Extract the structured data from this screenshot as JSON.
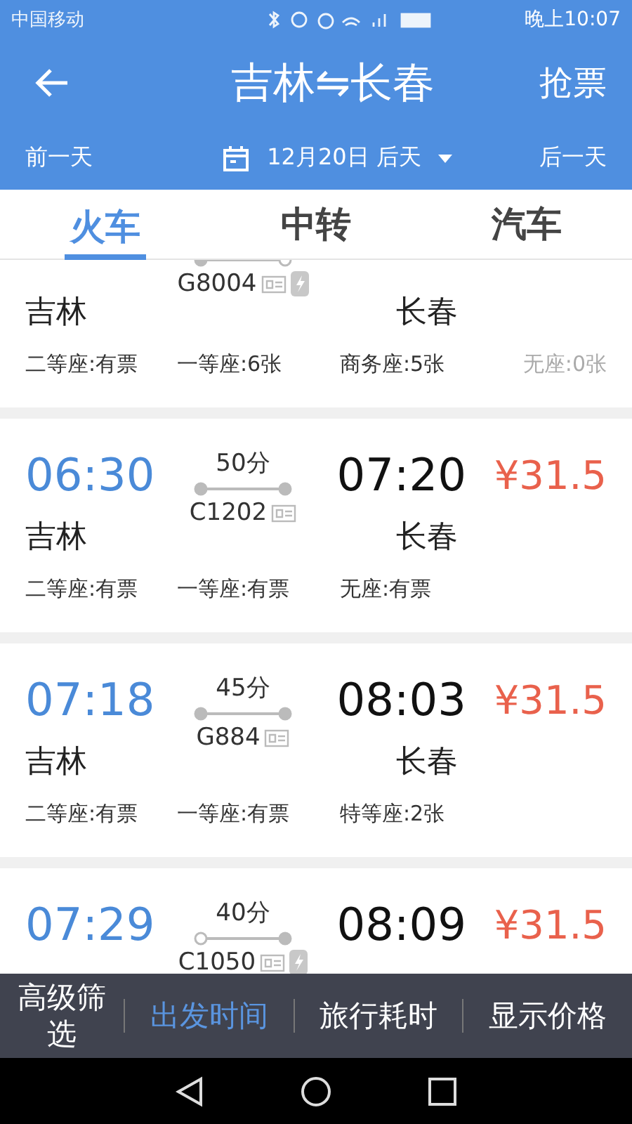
{
  "status_bar": {
    "carrier": "中国移动",
    "time": "晚上10:07"
  },
  "header": {
    "title": "吉林⇋长春",
    "action": "抢票"
  },
  "date_bar": {
    "prev": "前一天",
    "date": "12月20日 后天",
    "next": "后一天"
  },
  "tabs": [
    {
      "label": "火车",
      "selected": true
    },
    {
      "label": "中转",
      "selected": false
    },
    {
      "label": "汽车",
      "selected": false
    }
  ],
  "trains": [
    {
      "from": "吉林",
      "number": "G8004",
      "to": "长春",
      "origin": true,
      "terminal": false,
      "id_icon": true,
      "s_icon": true,
      "seats": [
        {
          "text": "二等座:有票",
          "available": true
        },
        {
          "text": "一等座:6张",
          "available": true
        },
        {
          "text": "商务座:5张",
          "available": true
        },
        {
          "text": "无座:0张",
          "available": false
        }
      ]
    },
    {
      "depart": "06:30",
      "duration": "50分",
      "arrive": "07:20",
      "price": "¥31.5",
      "from": "吉林",
      "number": "C1202",
      "to": "长春",
      "origin": true,
      "terminal": true,
      "id_icon": true,
      "s_icon": false,
      "seats": [
        {
          "text": "二等座:有票",
          "available": true
        },
        {
          "text": "一等座:有票",
          "available": true
        },
        {
          "text": "无座:有票",
          "available": true
        }
      ]
    },
    {
      "depart": "07:18",
      "duration": "45分",
      "arrive": "08:03",
      "price": "¥31.5",
      "from": "吉林",
      "number": "G884",
      "to": "长春",
      "origin": true,
      "terminal": true,
      "id_icon": true,
      "s_icon": false,
      "seats": [
        {
          "text": "二等座:有票",
          "available": true
        },
        {
          "text": "一等座:有票",
          "available": true
        },
        {
          "text": "特等座:2张",
          "available": true
        }
      ]
    },
    {
      "depart": "07:29",
      "duration": "40分",
      "arrive": "08:09",
      "price": "¥31.5",
      "number": "C1050",
      "origin": false,
      "terminal": true,
      "id_icon": true,
      "s_icon": true
    }
  ],
  "bottom_bar": [
    {
      "label": "高级筛选",
      "selected": false
    },
    {
      "label": "出发时间",
      "selected": true
    },
    {
      "label": "旅行耗时",
      "selected": false
    },
    {
      "label": "显示价格",
      "selected": false
    }
  ]
}
